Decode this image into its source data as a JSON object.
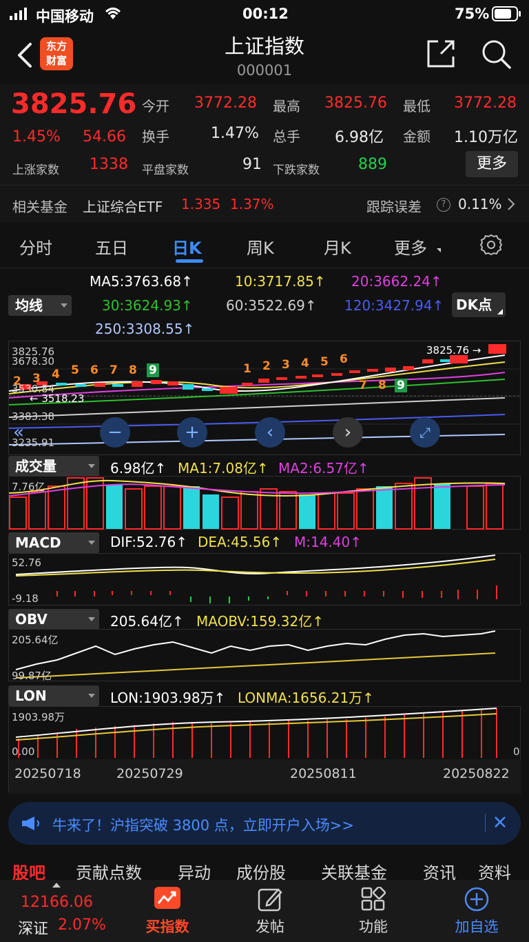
{
  "status": {
    "carrier": "中国移动",
    "time": "00:12",
    "battery": "75%"
  },
  "header": {
    "logo_line1": "东方",
    "logo_line2": "财富",
    "title": "上证指数",
    "code": "000001"
  },
  "quote": {
    "price": "3825.76",
    "pct": "1.45%",
    "chg": "54.66",
    "open_label": "今开",
    "open": "3772.28",
    "high_label": "最高",
    "high": "3825.76",
    "low_label": "最低",
    "low": "3772.28",
    "turnover_label": "换手",
    "turnover": "1.47%",
    "volume_label": "总手",
    "volume": "6.98亿",
    "amount_label": "金额",
    "amount": "1.10万亿",
    "up_label": "上涨家数",
    "up": "1338",
    "flat_label": "平盘家数",
    "flat": "91",
    "down_label": "下跌家数",
    "down": "889",
    "more": "更多"
  },
  "fund": {
    "label": "相关基金",
    "name": "上证综合ETF",
    "price": "1.335",
    "pct": "1.37%",
    "track_label": "跟踪误差",
    "track": "0.11%"
  },
  "tabs": [
    "分时",
    "五日",
    "日K",
    "周K",
    "月K",
    "更多"
  ],
  "active_tab": "日K",
  "ma": {
    "dropdown": "均线",
    "ma5": "MA5:3763.68↑",
    "ma10": "10:3717.85↑",
    "ma20": "20:3662.24↑",
    "ma30": "30:3624.93↑",
    "ma60": "60:3522.69↑",
    "ma120": "120:3427.94↑",
    "ma250": "250:3308.55↑",
    "dk": "DK点"
  },
  "kline": {
    "yticks": [
      "3825.76",
      "3678.30",
      "3530.84",
      "3383.38",
      "3235.91"
    ],
    "low_mark": "3518.23",
    "high_mark": "3825.76",
    "seq1": [
      "2",
      "3",
      "4",
      "5",
      "6",
      "7",
      "8",
      "9"
    ],
    "seq2": [
      "1",
      "2",
      "3",
      "4",
      "5",
      "6"
    ],
    "seq3": [
      "7",
      "8",
      "9"
    ]
  },
  "volume": {
    "dropdown": "成交量",
    "value": "6.98亿↑",
    "ma1": "MA1:7.08亿↑",
    "ma2": "MA2:6.57亿↑",
    "ytick": "7.76亿"
  },
  "macd": {
    "dropdown": "MACD",
    "dif": "DIF:52.76↑",
    "dea": "DEA:45.56↑",
    "m": "M:14.40↑",
    "ytop": "52.76",
    "ybot": "-9.18"
  },
  "obv": {
    "dropdown": "OBV",
    "value": "205.64亿↑",
    "maobv": "MAOBV:159.32亿↑",
    "ytop": "205.64亿",
    "ybot": "99.87亿"
  },
  "lon": {
    "dropdown": "LON",
    "value": "LON:1903.98万↑",
    "lonma": "LONMA:1656.21万↑",
    "ytop": "1903.98万",
    "ybot": "0.00",
    "yright": "0"
  },
  "dates": [
    "20250718",
    "20250729",
    "20250811",
    "20250822"
  ],
  "banner": {
    "text": "牛来了！沪指突破 3800 点，立即开户入场>>"
  },
  "subtabs": [
    "股吧",
    "贡献点数",
    "异动",
    "成份股",
    "关联基金",
    "资讯",
    "资料"
  ],
  "bottom": {
    "sz_value": "12166.06",
    "sz_label": "深证",
    "sz_pct": "2.07%",
    "buy": "买指数",
    "post": "发帖",
    "func": "功能",
    "add": "加自选"
  },
  "colors": {
    "up": "#ff2b2b",
    "down": "#2ad6dc",
    "ma5": "#ffffff",
    "ma10": "#f2e14b",
    "ma20": "#e040e0",
    "ma30": "#2ec22e",
    "ma60": "#cfcfcf",
    "ma120": "#4a5cf0",
    "ma250": "#b0c8ff"
  }
}
